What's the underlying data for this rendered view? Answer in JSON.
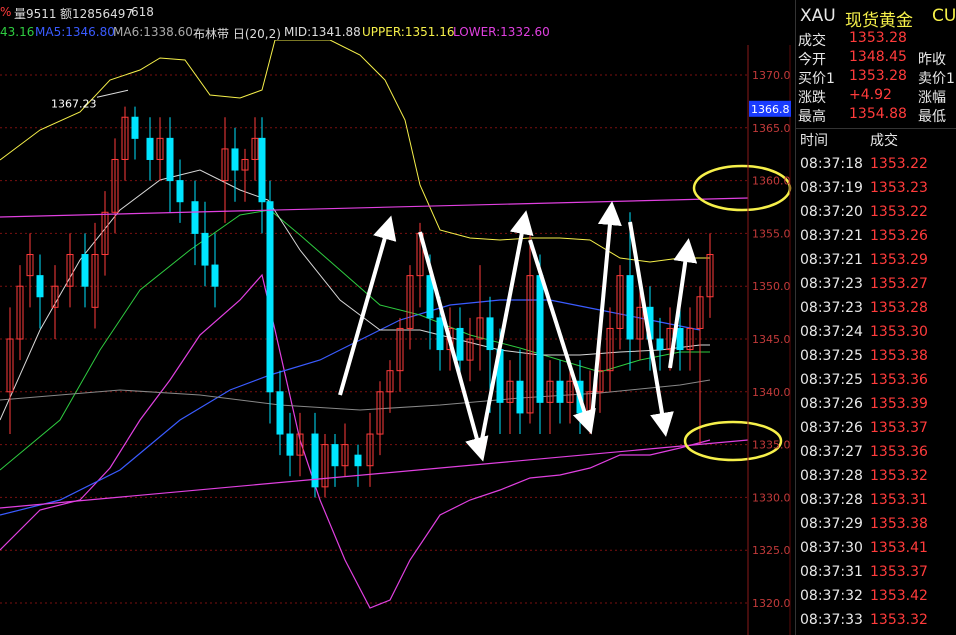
{
  "header": {
    "pct_fragment": "%",
    "volume": "量9511",
    "amount": "额12856497",
    "extra": "618"
  },
  "indicators": {
    "ma_first_fragment": "43.16",
    "ma5": "MA5:1346.80",
    "ma6": "MA6:1338.60",
    "boll_name": "布林带 日(20,2)",
    "mid": "MID:1341.88",
    "upper": "UPPER:1351.16",
    "lower": "LOWER:1332.60"
  },
  "colors": {
    "up": "#ff3b3b",
    "down": "#00e5ff",
    "upper_band": "#f6f04a",
    "lower_band": "#e040e0",
    "ma5": "#3a5bff",
    "ma_green": "#2ecc40",
    "grid": "#7a1010",
    "circle": "#f6f04a",
    "price_label_bg": "#1a3cff"
  },
  "chart_data": {
    "type": "candlestick",
    "yaxis_ticks": [
      "1370.0",
      "1365.0",
      "1360.0",
      "1355.0",
      "1350.0",
      "1345.0",
      "1340.0",
      "1335.0",
      "1330.0",
      "1325.0",
      "1320.0"
    ],
    "ylim": [
      1317,
      1373
    ],
    "current_price_label": "1366.8",
    "current_price_value": 1366.8,
    "high_label": "1367.23",
    "high_value": 1367.23
  },
  "symbol": {
    "code": "XAU",
    "name": "现货黄金",
    "suffix": "CU"
  },
  "quote": {
    "deal_label": "成交",
    "deal_value": "1353.28",
    "open_label": "今开",
    "open_value": "1348.45",
    "prev_label": "昨收",
    "bid_label": "买价1",
    "bid_value": "1353.28",
    "ask_label": "卖价1",
    "change_label": "涨跌",
    "change_value": "+4.92",
    "change_pct_label": "涨幅",
    "high_label": "最高",
    "high_value": "1354.88",
    "low_label": "最低"
  },
  "ticks_header": {
    "time": "时间",
    "deal": "成交"
  },
  "ticks": [
    {
      "time": "08:37:18",
      "price": "1353.22"
    },
    {
      "time": "08:37:19",
      "price": "1353.23"
    },
    {
      "time": "08:37:20",
      "price": "1353.22"
    },
    {
      "time": "08:37:21",
      "price": "1353.26"
    },
    {
      "time": "08:37:21",
      "price": "1353.29"
    },
    {
      "time": "08:37:23",
      "price": "1353.27"
    },
    {
      "time": "08:37:23",
      "price": "1353.28"
    },
    {
      "time": "08:37:24",
      "price": "1353.30"
    },
    {
      "time": "08:37:25",
      "price": "1353.38"
    },
    {
      "time": "08:37:25",
      "price": "1353.36"
    },
    {
      "time": "08:37:26",
      "price": "1353.39"
    },
    {
      "time": "08:37:26",
      "price": "1353.37"
    },
    {
      "time": "08:37:27",
      "price": "1353.36"
    },
    {
      "time": "08:37:28",
      "price": "1353.32"
    },
    {
      "time": "08:37:28",
      "price": "1353.31"
    },
    {
      "time": "08:37:29",
      "price": "1353.38"
    },
    {
      "time": "08:37:30",
      "price": "1353.41"
    },
    {
      "time": "08:37:31",
      "price": "1353.37"
    },
    {
      "time": "08:37:32",
      "price": "1353.42"
    },
    {
      "time": "08:37:33",
      "price": "1353.32"
    }
  ]
}
